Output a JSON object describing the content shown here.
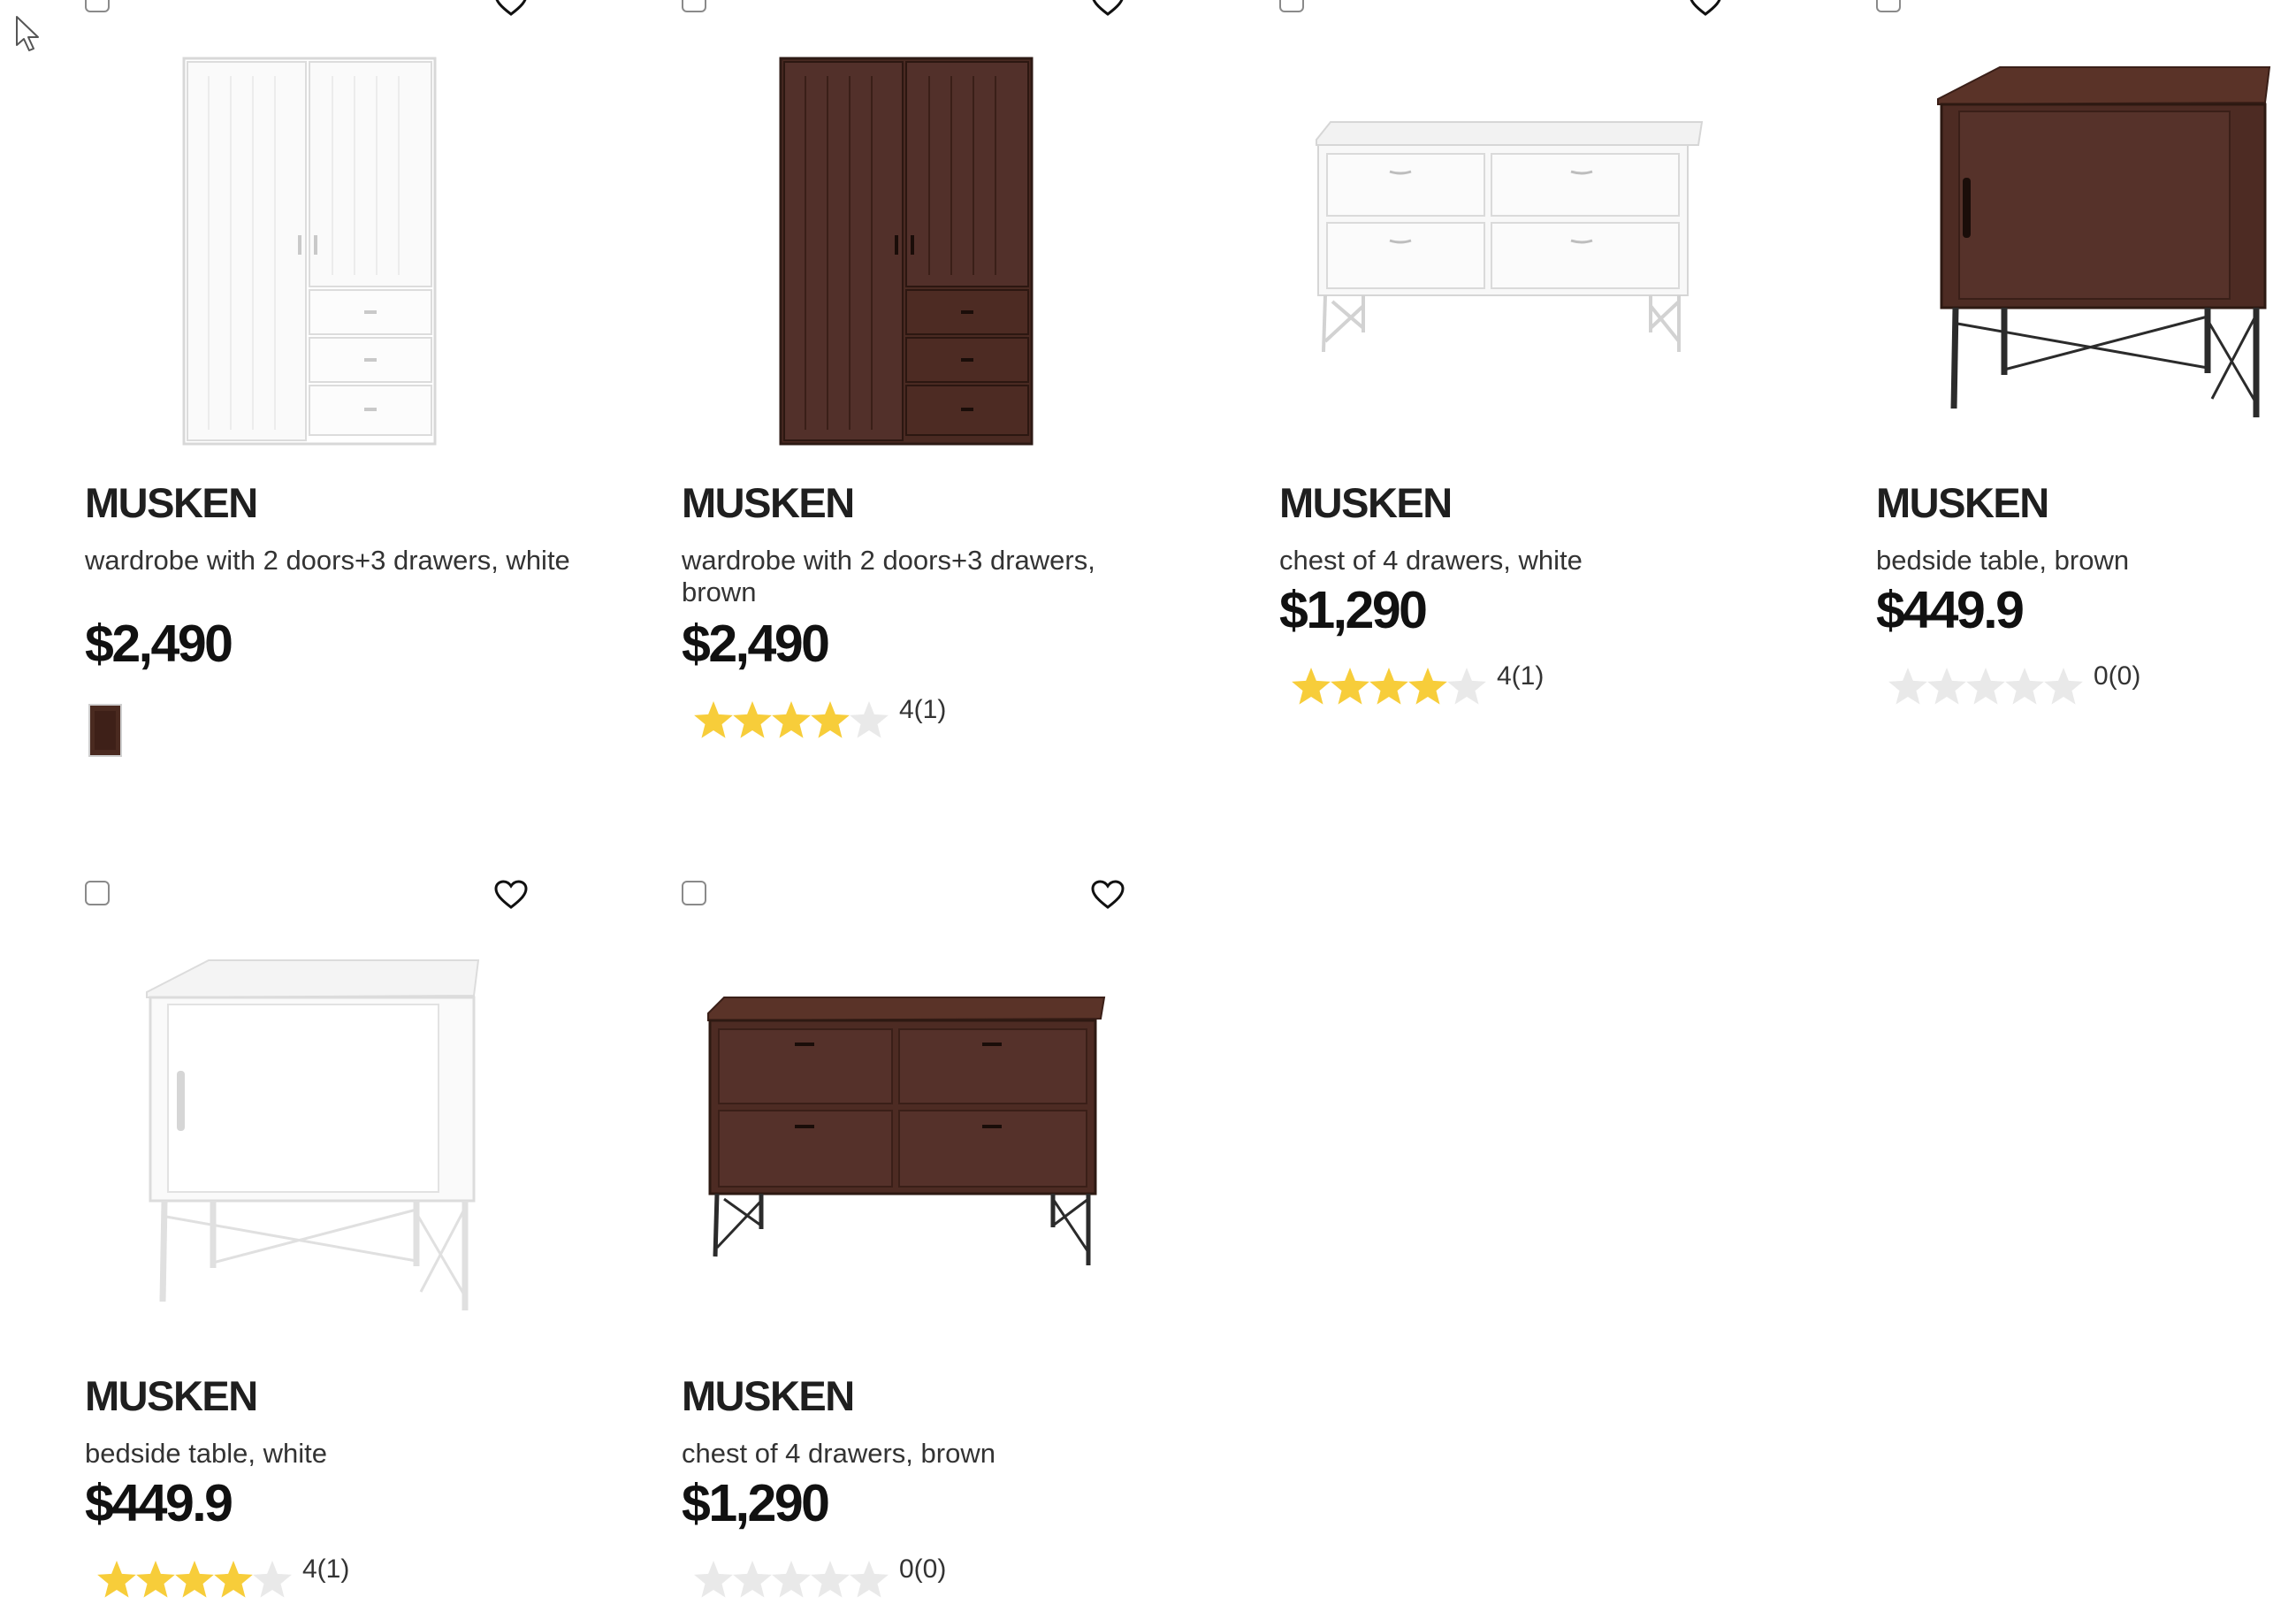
{
  "products": [
    {
      "name": "MUSKEN",
      "description": "wardrobe with 2 doors+3 drawers, white",
      "price": "$2,490",
      "variant_swatch": "brown",
      "image": "white-wardrobe"
    },
    {
      "name": "MUSKEN",
      "description": "wardrobe with 2 doors+3 drawers, brown",
      "price": "$2,490",
      "rating": {
        "stars": 4,
        "max": 5,
        "count_label": "4(1)"
      },
      "image": "brown-wardrobe"
    },
    {
      "name": "MUSKEN",
      "description": "chest of 4 drawers, white",
      "price": "$1,290",
      "rating": {
        "stars": 4,
        "max": 5,
        "count_label": "4(1)"
      },
      "image": "white-chest"
    },
    {
      "name": "MUSKEN",
      "description": "bedside table, brown",
      "price": "$449.9",
      "rating": {
        "stars": 0,
        "max": 5,
        "count_label": "0(0)"
      },
      "image": "brown-bedside"
    },
    {
      "name": "MUSKEN",
      "description": "bedside table, white",
      "price": "$449.9",
      "rating": {
        "stars": 4,
        "max": 5,
        "count_label": "4(1)"
      },
      "image": "white-bedside"
    },
    {
      "name": "MUSKEN",
      "description": "chest of 4 drawers, brown",
      "price": "$1,290",
      "rating": {
        "stars": 0,
        "max": 5,
        "count_label": "0(0)"
      },
      "image": "brown-chest"
    }
  ],
  "colors": {
    "star_filled": "#f7cd3a",
    "star_empty": "#e9e9e9",
    "wood_brown": "#4b2a20",
    "white_furniture": "#ffffff",
    "text_dark": "#111111"
  },
  "icons": [
    "compare-checkbox",
    "heart-icon",
    "star-icon",
    "cursor-arrow-icon"
  ]
}
